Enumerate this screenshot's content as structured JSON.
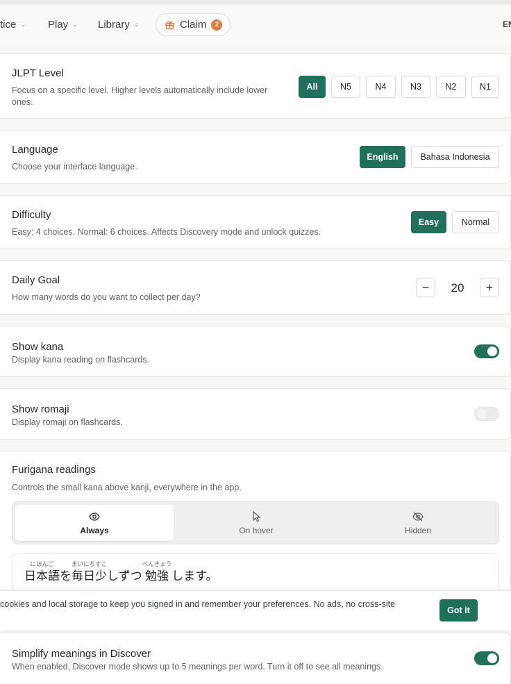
{
  "nav": {
    "items": [
      {
        "label": "tice"
      },
      {
        "label": "Play"
      },
      {
        "label": "Library"
      }
    ],
    "claim_label": "Claim",
    "claim_count": "2",
    "language_code": "EN"
  },
  "jlpt": {
    "title": "JLPT Level",
    "description": "Focus on a specific level. Higher levels automatically include lower ones.",
    "options": [
      "All",
      "N5",
      "N4",
      "N3",
      "N2",
      "N1"
    ],
    "selected": "All"
  },
  "language": {
    "title": "Language",
    "description": "Choose your interface language.",
    "options": [
      "English",
      "Bahasa Indonesia"
    ],
    "selected": "English"
  },
  "difficulty": {
    "title": "Difficulty",
    "description": "Easy: 4 choices. Normal: 6 choices. Affects Discovery mode and unlock quizzes.",
    "options": [
      "Easy",
      "Normal"
    ],
    "selected": "Easy"
  },
  "daily_goal": {
    "title": "Daily Goal",
    "description": "How many words do you want to collect per day?",
    "decrement": "−",
    "value": "20",
    "increment": "+"
  },
  "show_kana": {
    "title": "Show kana",
    "description": "Display kana reading on flashcards.",
    "enabled": true
  },
  "show_romaji": {
    "title": "Show romaji",
    "description": "Display romaji on flashcards.",
    "enabled": false
  },
  "furigana": {
    "title": "Furigana readings",
    "description": "Controls the small kana above kanji, everywhere in the app.",
    "options": [
      {
        "label": "Always",
        "icon": "eye-icon"
      },
      {
        "label": "On hover",
        "icon": "cursor-icon"
      },
      {
        "label": "Hidden",
        "icon": "eye-off-icon"
      }
    ],
    "selected": "Always",
    "preview": {
      "segments": [
        {
          "base": "日本語",
          "ruby": "にほんご"
        },
        {
          "base": "を",
          "ruby": ""
        },
        {
          "base": "毎日",
          "ruby": "まいにち"
        },
        {
          "base": "少",
          "ruby": "すこ"
        },
        {
          "base": "しずつ",
          "ruby": ""
        },
        {
          "base": "勉強",
          "ruby": "べんきょう"
        },
        {
          "base": "します。",
          "ruby": ""
        }
      ]
    }
  },
  "cookie_banner": {
    "text": "cookies and local storage to keep you signed in and remember your preferences. No ads, no cross-site",
    "button": "Got it"
  },
  "simplify": {
    "title": "Simplify meanings in Discover",
    "description": "When enabled, Discover mode shows up to 5 meanings per word. Turn it off to see all meanings.",
    "enabled": true
  },
  "colors": {
    "accent": "#21705c",
    "badge": "#e07a3b",
    "background": "#f7f7f5"
  }
}
